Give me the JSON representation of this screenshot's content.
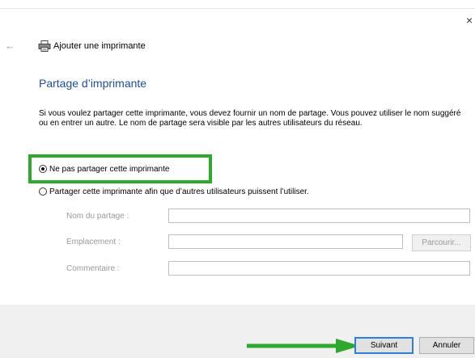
{
  "window": {
    "title": "Ajouter une imprimante",
    "close_glyph": "×",
    "back_glyph": "←"
  },
  "heading": "Partage d’imprimante",
  "description": "Si vous voulez partager cette imprimante, vous devez fournir un nom de partage. Vous pouvez utiliser le nom suggéré ou en entrer un autre. Le nom de partage sera visible par les autres utilisateurs du réseau.",
  "options": {
    "no_share": {
      "label": "Ne pas partager cette imprimante",
      "selected": true
    },
    "share": {
      "label": "Partager cette imprimante afin que d’autres utilisateurs puissent l’utiliser.",
      "selected": false
    }
  },
  "fields": {
    "share_name": {
      "label": "Nom du partage :",
      "value": ""
    },
    "location": {
      "label": "Emplacement :",
      "value": ""
    },
    "comment": {
      "label": "Commentaire :",
      "value": ""
    }
  },
  "buttons": {
    "browse": "Parcourir...",
    "next": "Suivant",
    "cancel": "Annuler"
  },
  "colors": {
    "heading": "#1f4e96",
    "highlight": "#2fa82e",
    "focus_border": "#2f7fd6",
    "footer_bg": "#f0f0f0"
  },
  "icons": {
    "back": "back-arrow-icon",
    "printer": "printer-icon",
    "close": "close-icon"
  }
}
